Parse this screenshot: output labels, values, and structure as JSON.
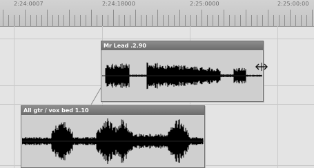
{
  "ruler": {
    "labels": [
      "2:24:0007",
      "2:24:18000",
      "2:25:0000",
      "2:25:00:00"
    ]
  },
  "clips": {
    "lead": {
      "title": "Mr Lead .2.90"
    },
    "bed": {
      "title": "All gtr / vox bed 1.10"
    }
  },
  "icons": {
    "trim_handle": "resize-horizontal-icon"
  },
  "colors": {
    "waveform": "#000000",
    "clip_title_bar": "#7a7a7a",
    "clip_body": "#cfcfcf",
    "track_background": "#e4e4e4"
  }
}
